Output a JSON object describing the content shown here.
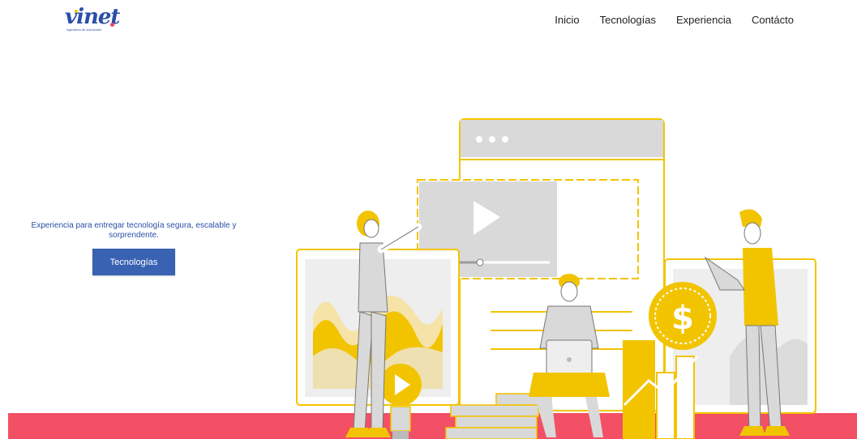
{
  "brand": {
    "logo_text": "vinet",
    "tagline_small": "ingeniería de soluciones"
  },
  "nav": {
    "items": [
      {
        "label": "Inicio"
      },
      {
        "label": "Tecnologías"
      },
      {
        "label": "Experiencia"
      },
      {
        "label": "Contácto"
      }
    ]
  },
  "hero": {
    "tagline": "Experiencia para entregar tecnología segura, escalable y sorprendente.",
    "cta_label": "Tecnologías",
    "dollar_symbol": "$"
  },
  "colors": {
    "brand_blue": "#2a4fa8",
    "button_blue": "#3a62b3",
    "accent_yellow": "#f2c400",
    "band_pink": "#f34f65",
    "illustration_gray": "#d9d9d9"
  }
}
